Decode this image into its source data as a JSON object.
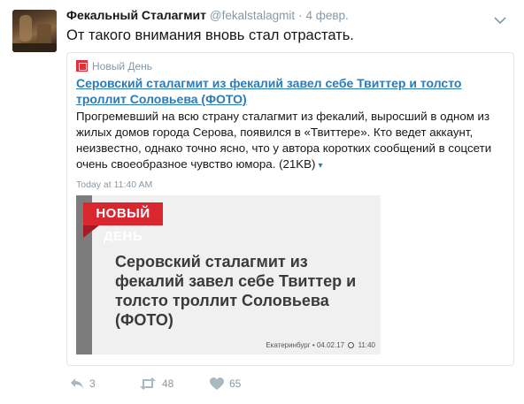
{
  "tweet": {
    "author_name": "Фекальный Сталагмит",
    "author_handle": "@fekalstalagmit",
    "separator": "·",
    "date": "4 февр.",
    "text": "От такого внимания вновь стал отрастать."
  },
  "card": {
    "site_name": "Новый День",
    "title": "Серовский сталагмит из фекалий завел себе Твиттер и толсто троллит Соловьева (ФОТО)",
    "description": "Прогремевший на всю страну сталагмит из фекалий, выросший в одном из жилых домов города Серова, появился в «Твиттере». Кто ведет аккаунт, неизвестно, однако точно ясно, что у автора коротких сообщений в соцсети очень своеобразное чувство юмора. (21KB)",
    "expand_glyph": "▾",
    "timestamp": "Today at 11:40 AM",
    "preview": {
      "logo_text": "НОВЫЙ ДЕНЬ",
      "headline": "Серовский сталагмит из фекалий завел себе Твиттер и толсто троллит Соловьева (ФОТО)",
      "city": "Екатеринбург",
      "separator": "•",
      "date": "04.02.17",
      "time": "11:40"
    }
  },
  "actions": {
    "reply_count": "3",
    "retweet_count": "48",
    "like_count": "65"
  },
  "colors": {
    "link": "#2b7bb9",
    "muted": "#8899a6",
    "brand_red": "#d9262f"
  }
}
